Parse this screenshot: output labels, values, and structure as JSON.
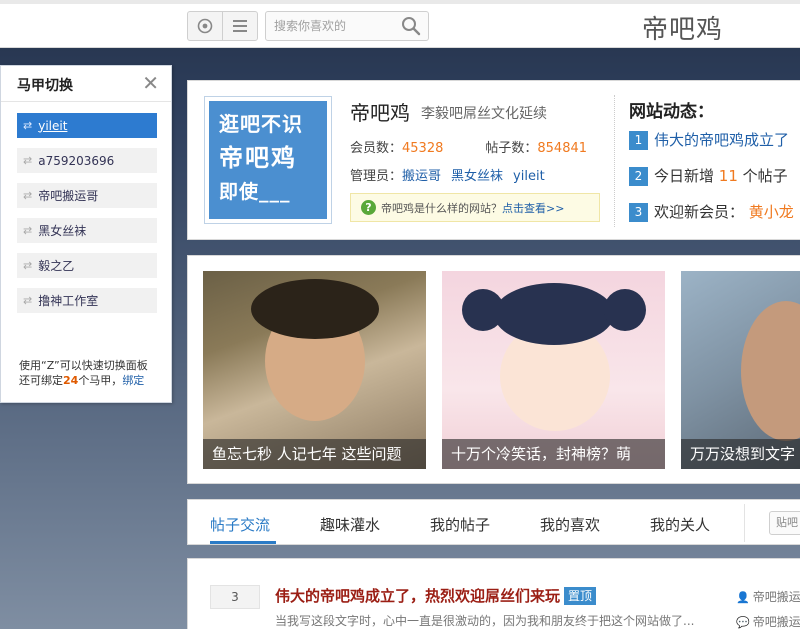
{
  "topbar": {
    "search_placeholder": "搜索你喜欢的",
    "site_logo": "帝吧鸡"
  },
  "panel": {
    "title": "马甲切换",
    "accounts": [
      {
        "label": "yileit",
        "active": true
      },
      {
        "label": "a759203696",
        "active": false
      },
      {
        "label": "帝吧搬运哥",
        "active": false
      },
      {
        "label": "黑女丝袜",
        "active": false
      },
      {
        "label": "毅之乙",
        "active": false
      },
      {
        "label": "撸神工作室",
        "active": false
      }
    ],
    "footer_line1": "使用“Z”可以快速切换面板",
    "footer_line2_prefix": "还可绑定",
    "footer_count": "24",
    "footer_line2_suffix": "个马甲，",
    "footer_link": "绑定"
  },
  "site": {
    "logo_line1": "逛吧不识",
    "logo_line2": "帝吧鸡",
    "logo_line3": "即使___",
    "name": "帝吧鸡",
    "slogan": "李毅吧屌丝文化延续",
    "members_label": "会员数：",
    "members_value": "45328",
    "posts_label": "帖子数：",
    "posts_value": "854841",
    "admins_label": "管理员：",
    "admins": [
      "搬运哥",
      "黑女丝袜",
      "yileit"
    ],
    "help_text": "帝吧鸡是什么样的网站？",
    "help_link": "点击查看>>"
  },
  "news": {
    "title": "网站动态：",
    "items": [
      {
        "num": "1",
        "text": "伟大的帝吧鸡成立了"
      },
      {
        "num": "2",
        "prefix": "今日新增",
        "count": "11",
        "suffix": "个帖子"
      },
      {
        "num": "3",
        "prefix": "欢迎新会员：",
        "user": "黄小龙"
      }
    ]
  },
  "photos": [
    {
      "caption": "鱼忘七秒 人记七年 这些问题"
    },
    {
      "caption": "十万个冷笑话，封神榜？萌"
    },
    {
      "caption": "万万没想到文字"
    }
  ],
  "tabs": {
    "items": [
      "帖子交流",
      "趣味灌水",
      "我的帖子",
      "我的喜欢",
      "我的关人"
    ],
    "active_index": 0,
    "search_placeholder": "贴吧"
  },
  "post": {
    "reply_count": "3",
    "title": "伟大的帝吧鸡成立了，热烈欢迎屌丝们来玩",
    "badge": "置顶",
    "excerpt": "当我写这段文字时，心中一直是很激动的，因为我和朋友终于把这个网站做了...",
    "author": "帝吧搬运",
    "last_reply": "帝吧搬运"
  },
  "colors": {
    "accent": "#2b7bc6",
    "highlight": "#f07a20",
    "post_title": "#9b1e14"
  }
}
